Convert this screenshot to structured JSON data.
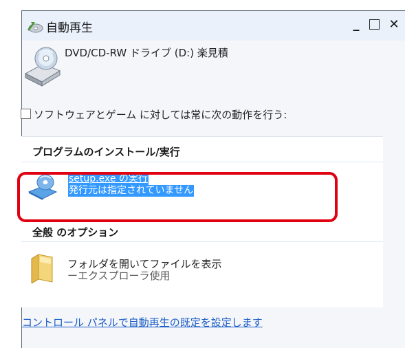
{
  "window": {
    "title": "自動再生",
    "controls": {
      "minimize": "_",
      "close": "✕"
    },
    "icon": "autoplay-cd-icon"
  },
  "device": {
    "label": "DVD/CD-RW ドライブ (D:) 楽見積",
    "icon": "dvd-drive-icon"
  },
  "checkbox": {
    "label": "ソフトウェアとゲーム に対しては常に次の動作を行う:",
    "checked": false
  },
  "sections": {
    "install": {
      "header": "プログラムのインストール/実行",
      "item": {
        "line1": "setup.exe の実行",
        "line2": "発行元は指定されていません",
        "icon": "install-program-icon",
        "selected": true
      }
    },
    "general": {
      "header": "全般 のオプション",
      "item": {
        "line1": "フォルダを開いてファイルを表示",
        "line2": "ーエクスプローラ使用",
        "icon": "folder-icon"
      }
    }
  },
  "footer": {
    "link": "コントロール パネルで自動再生の既定を設定します"
  },
  "colors": {
    "selection": "#3399ff",
    "highlight_border": "#e00012",
    "link": "#1d5ec9",
    "titlebar": "#eaf1fb"
  }
}
